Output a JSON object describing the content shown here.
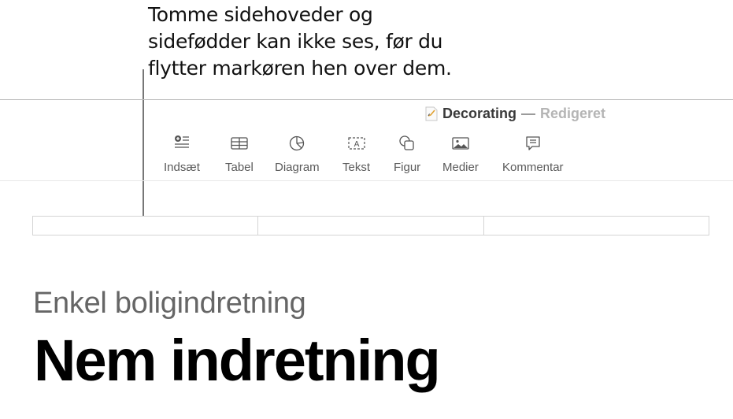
{
  "callout": {
    "lines": [
      "Tomme sidehoveder og",
      "sidefødder kan ikke ses, før du",
      "flytter markøren hen over dem."
    ]
  },
  "window": {
    "document_name": "Decorating",
    "separator": "—",
    "status": "Redigeret",
    "doc_icon": "pages-document-icon"
  },
  "toolbar": {
    "items": [
      {
        "label": "Indsæt",
        "icon": "insert-icon"
      },
      {
        "label": "Tabel",
        "icon": "table-icon"
      },
      {
        "label": "Diagram",
        "icon": "chart-icon"
      },
      {
        "label": "Tekst",
        "icon": "text-box-icon"
      },
      {
        "label": "Figur",
        "icon": "shape-icon"
      },
      {
        "label": "Medier",
        "icon": "media-icon"
      },
      {
        "label": "Kommentar",
        "icon": "comment-icon"
      }
    ]
  },
  "document": {
    "header_fields": [
      "",
      "",
      ""
    ],
    "subtitle": "Enkel boligindretning",
    "heading": "Nem indretning"
  }
}
